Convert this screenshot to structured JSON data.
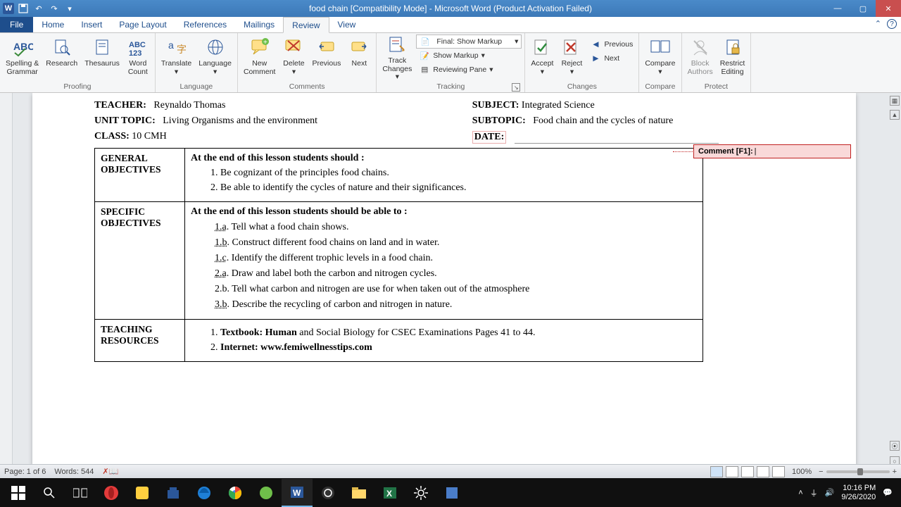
{
  "titlebar": {
    "title": "food chain [Compatibility Mode] - Microsoft Word (Product Activation Failed)"
  },
  "tabs": {
    "file": "File",
    "items": [
      "Home",
      "Insert",
      "Page Layout",
      "References",
      "Mailings",
      "Review",
      "View"
    ],
    "active": "Review"
  },
  "ribbon": {
    "proofing": {
      "label": "Proofing",
      "spelling": "Spelling &\nGrammar",
      "research": "Research",
      "thesaurus": "Thesaurus",
      "wordcount": "Word\nCount"
    },
    "language": {
      "label": "Language",
      "translate": "Translate",
      "language": "Language"
    },
    "comments": {
      "label": "Comments",
      "new": "New\nComment",
      "delete": "Delete",
      "previous": "Previous",
      "next": "Next"
    },
    "tracking": {
      "label": "Tracking",
      "track": "Track\nChanges",
      "display": "Final: Show Markup",
      "show": "Show Markup",
      "pane": "Reviewing Pane"
    },
    "changes": {
      "label": "Changes",
      "accept": "Accept",
      "reject": "Reject",
      "previous": "Previous",
      "next": "Next"
    },
    "compare": {
      "label": "Compare",
      "compare": "Compare"
    },
    "protect": {
      "label": "Protect",
      "block": "Block\nAuthors",
      "restrict": "Restrict\nEditing"
    }
  },
  "doc": {
    "teacher_label": "TEACHER:",
    "teacher": "Reynaldo Thomas",
    "subject_label": "SUBJECT:",
    "subject": "Integrated Science",
    "unit_label": "UNIT TOPIC:",
    "unit": "Living Organisms and the environment",
    "subtopic_label": "SUBTOPIC:",
    "subtopic": "Food chain and the cycles of nature",
    "class_label": "CLASS:",
    "class": "10 CMH",
    "date_label": "DATE:",
    "general_head": "GENERAL OBJECTIVES",
    "general_intro": "At the end of this lesson students should :",
    "general_items": [
      "Be cognizant of the principles food chains.",
      "Be able to identify the cycles of nature and their significances."
    ],
    "specific_head": "SPECIFIC OBJECTIVES",
    "specific_intro": "At the end of this lesson students should be able to :",
    "specific_items": [
      {
        "num": "1.a",
        "txt": "Tell what a food chain shows."
      },
      {
        "num": "1.b",
        "txt": "Construct different food chains on land and in water."
      },
      {
        "num": "1.c",
        "txt": "Identify the different trophic levels in a food chain."
      },
      {
        "num": "2.a",
        "txt": "Draw and label both the carbon and nitrogen cycles."
      },
      {
        "num": "2.b",
        "txt": "Tell what carbon and nitrogen are use for when taken out of the atmosphere"
      },
      {
        "num": "3.b",
        "txt": "Describe the recycling of carbon and nitrogen in nature."
      }
    ],
    "teaching_head": "TEACHING RESOURCES",
    "resources": [
      {
        "bold": "Textbook: Human",
        "rest": " and Social Biology for CSEC Examinations Pages 41 to 44."
      },
      {
        "bold": "Internet: www.femiwellnesstips.com",
        "rest": ""
      }
    ]
  },
  "comment": {
    "label": "Comment [F1]:",
    "text": "|"
  },
  "status": {
    "page": "Page: 1 of 6",
    "words": "Words: 544",
    "zoom": "100%"
  },
  "tray": {
    "time": "10:16 PM",
    "date": "9/26/2020"
  }
}
